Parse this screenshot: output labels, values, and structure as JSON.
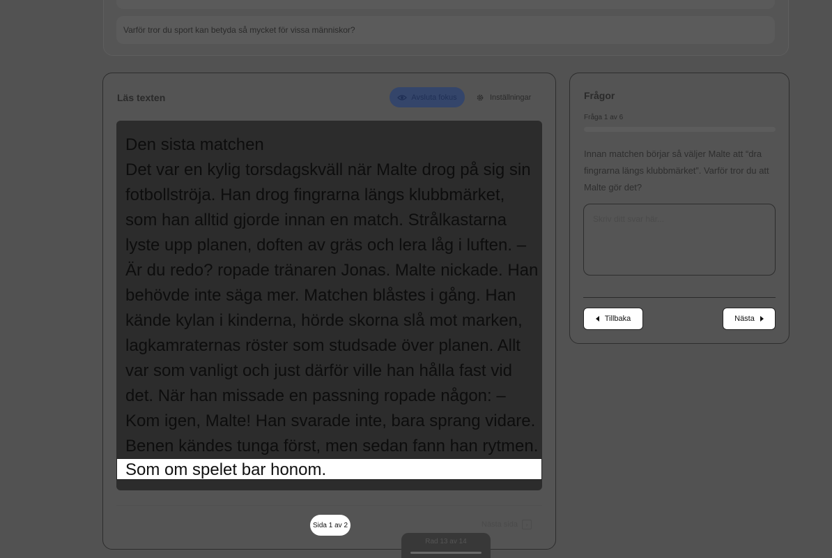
{
  "previous": {
    "question": "Varför tror du sport kan betyda så mycket för vissa människor?"
  },
  "reader": {
    "title": "Läs texten",
    "focus_label": "Avsluta fokus",
    "settings_label": "Inställningar",
    "lines": [
      "Den sista matchen",
      "Det var en kylig torsdagskväll när Malte drog på sig sin",
      "fotbollströja. Han drog fingrarna längs klubbmärket,",
      "som han alltid gjorde innan en match. Strålkastarna",
      "lyste upp planen, doften av gräs och lera låg i luften. –",
      "Är du redo? ropade tränaren Jonas. Malte nickade. Han",
      "behövde inte säga mer. Matchen blåstes i gång. Han",
      "kände kylan i kinderna, hörde skorna slå mot marken,",
      "lagkamraternas röster som studsade över planen. Allt",
      "var som vanligt och just därför ville han hålla fast vid",
      "det. När han missade en passning ropade någon: –",
      "Kom igen, Malte! Han svarade inte, bara sprang vidare.",
      "Benen kändes tunga först, men sedan fann han rytmen."
    ],
    "highlight_line": "Som om spelet bar honom.",
    "page_indicator": "Sida 1 av 2",
    "next_page_label": "Nästa sida"
  },
  "questions": {
    "title": "Frågor",
    "progress_label": "Fråga 1 av 6",
    "progress_fraction": 0.0,
    "question_text": "Innan matchen börjar så väljer Malte att “dra fingrarna längs klubbmärket”. Varför tror du att Malte gör det?",
    "answer_placeholder": "Skriv ditt svar här...",
    "back_label": "Tillbaka",
    "next_label": "Nästa"
  },
  "bottom": {
    "label": "Rad 13 av 14"
  }
}
